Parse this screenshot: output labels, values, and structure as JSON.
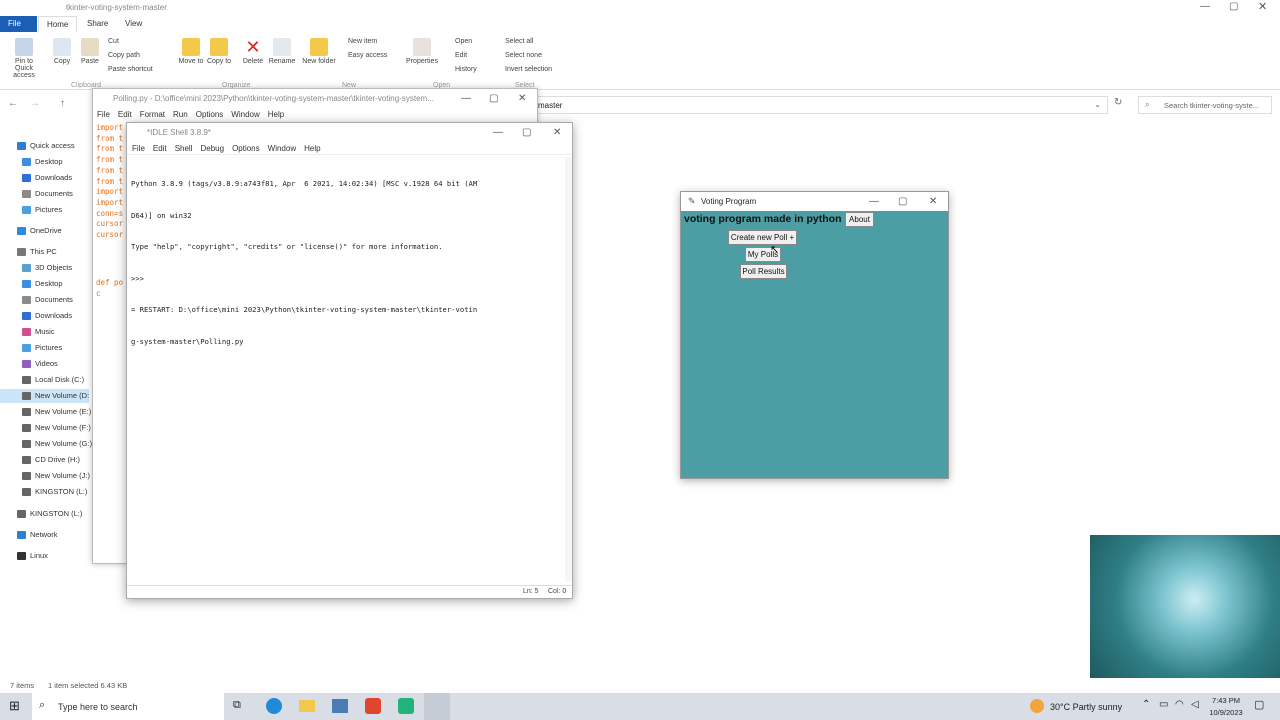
{
  "explorer": {
    "title": "tkinter-voting-system-master",
    "tabs": [
      "File",
      "Home",
      "Share",
      "View"
    ],
    "ribbon": {
      "pin": "Pin to Quick access",
      "copy": "Copy",
      "paste": "Paste",
      "cut": "Cut",
      "copy_path": "Copy path",
      "paste_shortcut": "Paste shortcut",
      "move_to": "Move to",
      "copy_to": "Copy to",
      "delete": "Delete",
      "rename": "Rename",
      "new_folder": "New folder",
      "new_item": "New item",
      "easy_access": "Easy access",
      "properties": "Properties",
      "open": "Open",
      "edit": "Edit",
      "history": "History",
      "select_all": "Select all",
      "select_none": "Select none",
      "invert_selection": "Invert selection",
      "groups": [
        "Clipboard",
        "Organize",
        "New",
        "Open",
        "Select"
      ]
    },
    "address_tail": "master",
    "search_placeholder": "Search tkinter-voting-syste...",
    "nav": [
      "Quick access",
      "Desktop",
      "Downloads",
      "Documents",
      "Pictures",
      "OneDrive",
      "This PC",
      "3D Objects",
      "Desktop",
      "Documents",
      "Downloads",
      "Music",
      "Pictures",
      "Videos",
      "Local Disk (C:)",
      "New Volume (D:",
      "New Volume (E:)",
      "New Volume (F:)",
      "New Volume (G:)",
      "CD Drive (H:)",
      "New Volume (J:)",
      "KINGSTON (L:)",
      "KINGSTON (L:)",
      "Network",
      "Linux"
    ],
    "status_items": "7 items",
    "status_selected": "1 item selected  6.43 KB"
  },
  "polling": {
    "title": "Polling.py - D:\\office\\mini 2023\\Python\\tkinter-voting-system-master\\tkinter-voting-system...",
    "menu": [
      "File",
      "Edit",
      "Format",
      "Run",
      "Options",
      "Window",
      "Help"
    ],
    "code": [
      "import",
      "from t",
      "from t",
      "from t",
      "from t",
      "from t",
      "import",
      "import",
      "conn=s",
      "cursor",
      "cursor",
      "",
      "",
      "def po",
      "    c"
    ]
  },
  "idle": {
    "title": "*IDLE Shell 3.8.9*",
    "menu": [
      "File",
      "Edit",
      "Shell",
      "Debug",
      "Options",
      "Window",
      "Help"
    ],
    "lines": [
      "Python 3.8.9 (tags/v3.8.9:a743f81, Apr  6 2021, 14:02:34) [MSC v.1928 64 bit (AM",
      "D64)] on win32",
      "Type \"help\", \"copyright\", \"credits\" or \"license()\" for more information.",
      ">>> ",
      "= RESTART: D:\\office\\mini 2023\\Python\\tkinter-voting-system-master\\tkinter-votin",
      "g-system-master\\Polling.py"
    ],
    "status_ln": "Ln: 5",
    "status_col": "Col: 0"
  },
  "voting": {
    "title": "Voting Program",
    "heading": "voting program made in python",
    "about": "About",
    "create": "Create new Poll +",
    "mypolls": "My Polls",
    "results": "Poll Results",
    "bg": "#4b9ea3"
  },
  "taskbar": {
    "search": "Type here to search",
    "weather": "30°C  Partly sunny",
    "time": "7:43 PM",
    "date": "10/9/2023"
  }
}
